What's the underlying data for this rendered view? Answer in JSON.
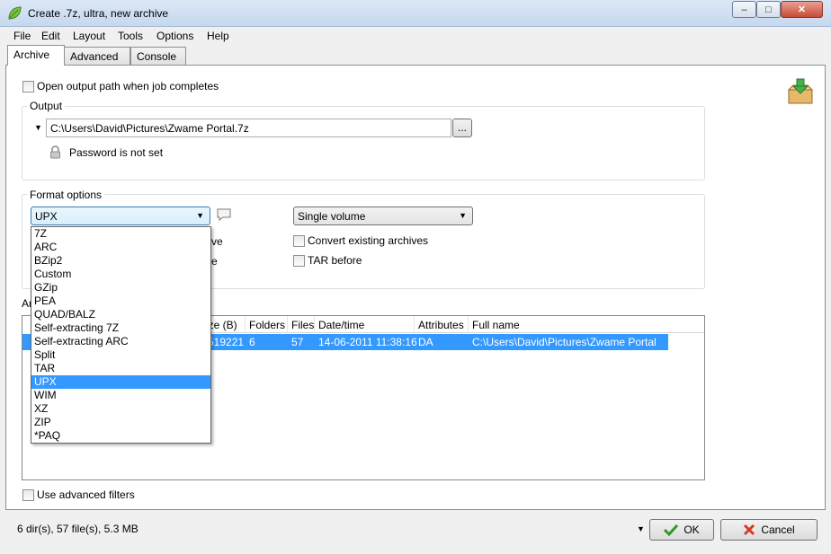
{
  "window": {
    "title": "Create .7z, ultra, new archive",
    "minimize": "–",
    "maximize": "□",
    "close": "✕"
  },
  "menu": [
    "File",
    "Edit",
    "Layout",
    "Tools",
    "Options",
    "Help"
  ],
  "tabs": [
    "Archive",
    "Advanced",
    "Console"
  ],
  "archive": {
    "open_output_label": "Open output path when job completes",
    "output_group": "Output",
    "output_path": "C:\\Users\\David\\Pictures\\Zwame Portal.7z",
    "browse_label": "...",
    "password_label": "Password is not set",
    "format_group": "Format options",
    "format_selected": "UPX",
    "volume_selected": "Single volume",
    "partial_label_1": "ve",
    "partial_label_2": "e",
    "convert_label": "Convert existing archives",
    "tar_before_label": "TAR before",
    "list_group_partial": "Ar",
    "use_filters_label": "Use advanced filters"
  },
  "format_options": [
    "7Z",
    "ARC",
    "BZip2",
    "Custom",
    "GZip",
    "PEA",
    "QUAD/BALZ",
    "Self-extracting 7Z",
    "Self-extracting ARC",
    "Split",
    "TAR",
    "UPX",
    "WIM",
    "XZ",
    "ZIP",
    "*PAQ"
  ],
  "format_selected_index": 11,
  "table": {
    "headers": [
      "ize (B)",
      "Folders",
      "Files",
      "Date/time",
      "Attributes",
      "Full name"
    ],
    "rows": [
      [
        "519221",
        "6",
        "57",
        "14-06-2011 11:38:16",
        "DA",
        "C:\\Users\\David\\Pictures\\Zwame Portal"
      ]
    ]
  },
  "status": {
    "summary": "6 dir(s), 57 file(s), 5.3 MB",
    "ok_label": "OK",
    "cancel_label": "Cancel"
  },
  "colors": {
    "selection": "#3399ff",
    "ok_icon": "#2e9b2e",
    "cancel_icon": "#d43a2a"
  }
}
